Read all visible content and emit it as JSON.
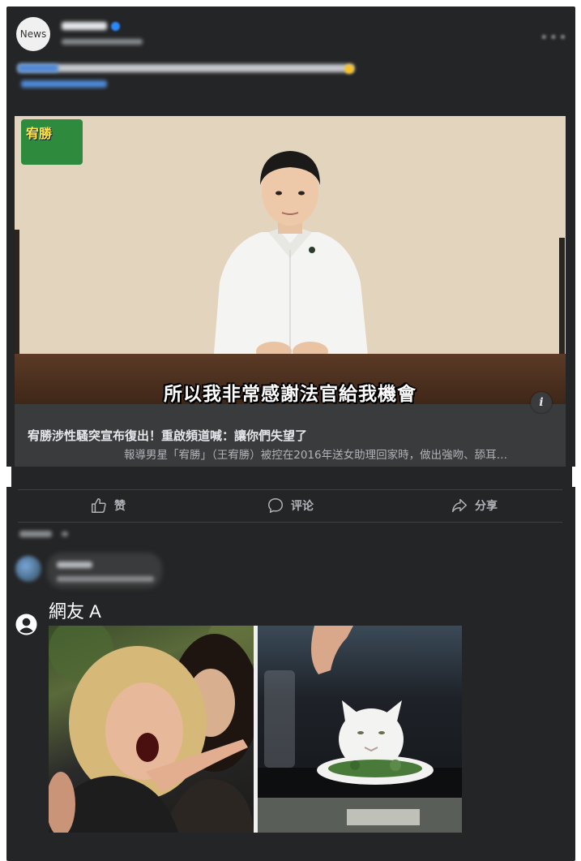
{
  "post": {
    "avatar_text": "News",
    "headline": "宥勝涉性騷突宣布復出！重啟頻道喊：讓你們失望了",
    "description": "報導男星「宥勝」（王宥勝）被控在2016年送女助理回家時，做出強吻、舔耳…",
    "video_subtitle": "所以我非常感謝法官給我機會",
    "channel_logo_text": "宥勝",
    "info_icon": "i"
  },
  "actions": {
    "like_label": "赞",
    "comment_label": "评论",
    "share_label": "分享"
  },
  "reply": {
    "user_name": "網友 A",
    "attachment": "woman-yelling-at-cat-meme"
  },
  "colors": {
    "card_bg": "#242526",
    "preview_bg": "#3a3b3c",
    "text_primary": "#e4e6eb",
    "text_secondary": "#b0b3b8",
    "link_blue": "#4e89d6"
  }
}
